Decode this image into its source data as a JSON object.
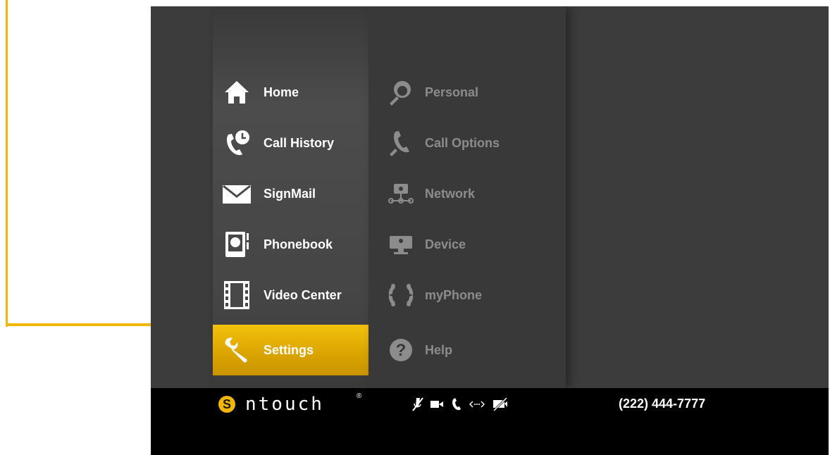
{
  "main_menu": [
    {
      "label": "Home",
      "icon": "home-icon"
    },
    {
      "label": "Call History",
      "icon": "call-history-icon"
    },
    {
      "label": "SignMail",
      "icon": "envelope-icon"
    },
    {
      "label": "Phonebook",
      "icon": "phonebook-icon"
    },
    {
      "label": "Video Center",
      "icon": "film-icon"
    },
    {
      "label": "Settings",
      "icon": "wrench-icon",
      "active": true
    }
  ],
  "settings_menu": [
    {
      "label": "Personal",
      "icon": "personal-icon"
    },
    {
      "label": "Call Options",
      "icon": "call-options-icon"
    },
    {
      "label": "Network",
      "icon": "network-icon"
    },
    {
      "label": "Device",
      "icon": "device-icon"
    },
    {
      "label": "myPhone",
      "icon": "myphone-icon"
    },
    {
      "label": "Help",
      "icon": "help-icon"
    }
  ],
  "statusbar": {
    "logo_text": "ntouch",
    "logo_tm": "®",
    "phone_number": "(222) 444-7777",
    "icons": [
      "mic-muted-icon",
      "video-camera-icon",
      "phone-icon",
      "connection-icon",
      "video-privacy-icon"
    ]
  },
  "colors": {
    "accent": "#f2b705",
    "menu_text": "#ffffff",
    "submenu_text": "#8c8c8c",
    "screen_bg": "#3c3c3c"
  }
}
